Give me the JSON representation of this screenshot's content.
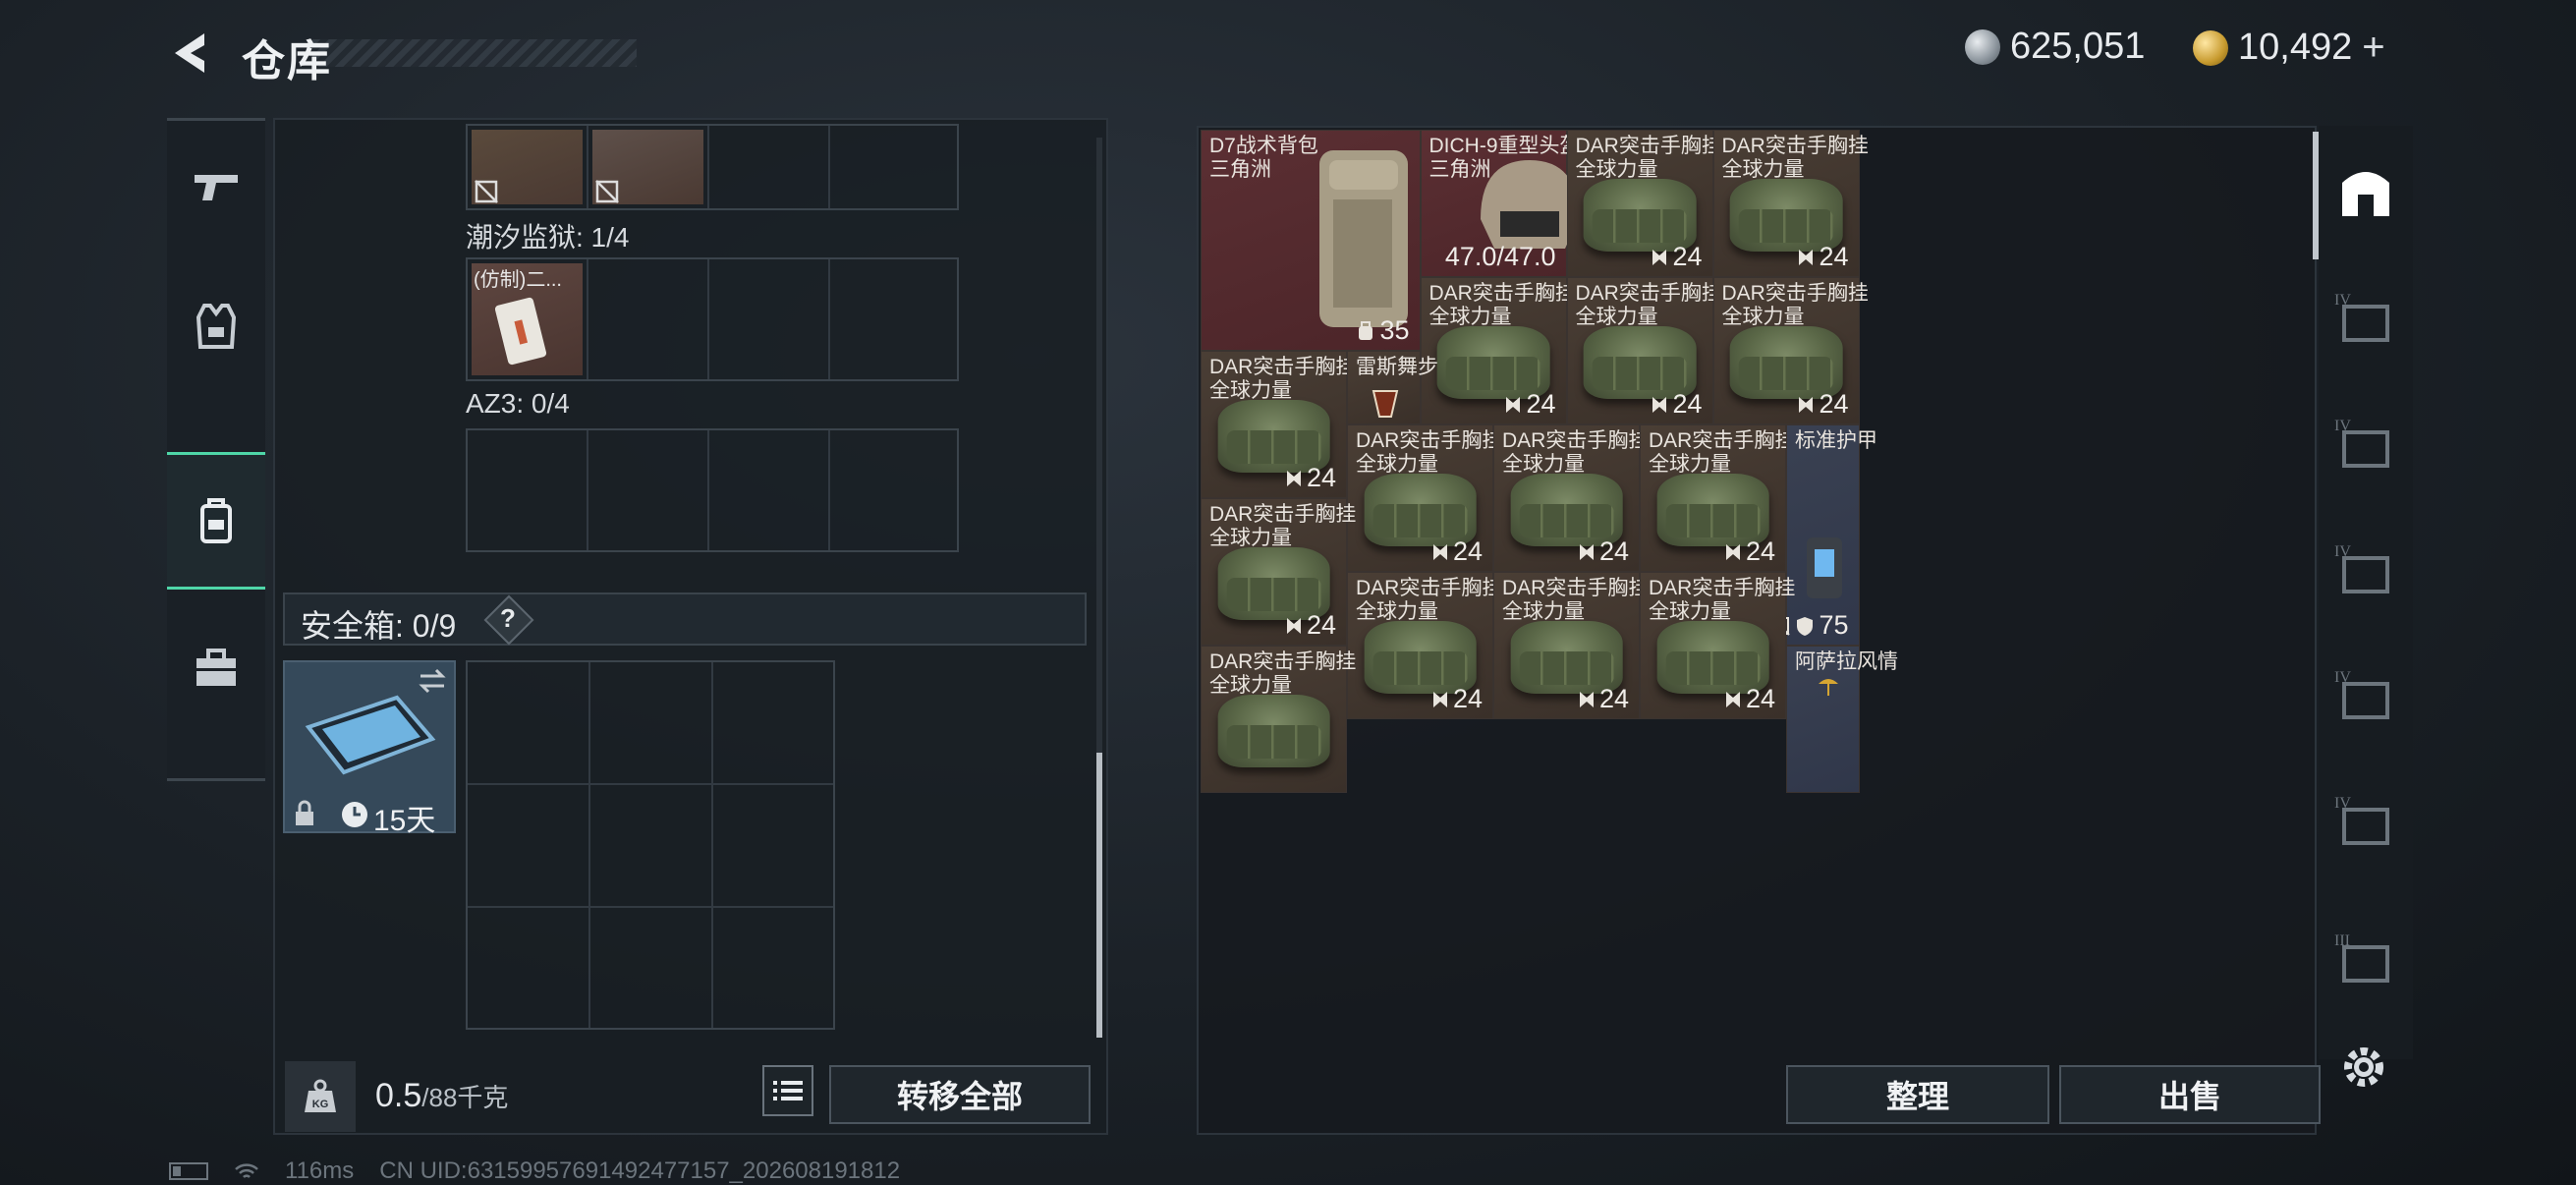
{
  "header": {
    "title": "仓库",
    "back_icon": "chevron-left-icon"
  },
  "currency": {
    "silver_value": "625,051",
    "gold_value": "10,492",
    "plus": "+"
  },
  "nav": {
    "items": [
      {
        "icon": "pistol-icon"
      },
      {
        "icon": "armor-vest-icon"
      },
      {
        "icon": "backpack-icon",
        "active": true
      },
      {
        "icon": "toolbox-icon"
      }
    ]
  },
  "left": {
    "row1_items": [
      {
        "icon": "no-trade-icon"
      },
      {
        "icon": "no-trade-icon"
      }
    ],
    "prison_label": "潮汐监狱: 1/4",
    "replica_label": "(仿制)二...",
    "az3_label": "AZ3: 0/4",
    "safe_label": "安全箱: 0/9",
    "safe_help": "?",
    "safe_days": "15天",
    "weight_value": "0.5",
    "weight_unit": "/88千克",
    "kg_label": "KG",
    "transfer_all": "转移全部"
  },
  "grid": {
    "items": [
      {
        "name": "D7战术背包",
        "sub": "三角洲",
        "count": "35",
        "count_icon": "capacity-icon",
        "color": "red"
      },
      {
        "name": "DICH-9重型头盔",
        "sub": "三角洲",
        "count": "47.0/47.0",
        "color": "red"
      },
      {
        "name": "DAR突击手胸挂",
        "sub": "全球力量",
        "count": "24",
        "color": "brown"
      },
      {
        "name": "DAR突击手胸挂",
        "sub": "全球力量",
        "count": "24",
        "color": "brown"
      },
      {
        "name": "DAR突击手胸挂",
        "sub": "全球力量",
        "count": "24",
        "color": "brown"
      },
      {
        "name": "DAR突击手胸挂",
        "sub": "全球力量",
        "count": "24",
        "color": "brown"
      },
      {
        "name": "DAR突击手胸挂",
        "sub": "全球力量",
        "count": "24",
        "color": "brown"
      },
      {
        "name": "DAR突击手胸挂",
        "sub": "全球力量",
        "count": "24",
        "color": "brown"
      },
      {
        "name": "雷斯舞步",
        "sub": "",
        "count": "",
        "color": "brown"
      },
      {
        "name": "DAR突击手胸挂",
        "sub": "全球力量",
        "count": "24",
        "color": "brown"
      },
      {
        "name": "DAR突击手胸挂",
        "sub": "全球力量",
        "count": "24",
        "color": "brown"
      },
      {
        "name": "DAR突击手胸挂",
        "sub": "全球力量",
        "count": "24",
        "color": "brown"
      },
      {
        "name": "标准护甲",
        "sub": "",
        "count": "75",
        "color": "blue"
      },
      {
        "name": "DAR突击手胸挂",
        "sub": "全球力量",
        "count": "24",
        "color": "brown"
      },
      {
        "name": "DAR突击手胸挂",
        "sub": "全球力量",
        "count": "24",
        "color": "brown"
      },
      {
        "name": "DAR突击手胸挂",
        "sub": "全球力量",
        "count": "24",
        "color": "brown"
      },
      {
        "name": "DAR突击手胸挂",
        "sub": "全球力量",
        "count": "24",
        "color": "brown"
      },
      {
        "name": "DAR突击手胸挂",
        "sub": "全球力量",
        "count": "",
        "color": "brown"
      },
      {
        "name": "阿萨拉风情",
        "sub": "",
        "count": "",
        "color": "blue"
      }
    ]
  },
  "actions": {
    "sort": "整理",
    "sell": "出售"
  },
  "rail": {
    "items": [
      {
        "icon": "storage-icon",
        "active": true
      },
      {
        "icon": "tier-iv-icon"
      },
      {
        "icon": "tier-iv-icon"
      },
      {
        "icon": "tier-iv-icon"
      },
      {
        "icon": "tier-iv-icon"
      },
      {
        "icon": "tier-iv-icon"
      },
      {
        "icon": "tier-iii-icon"
      }
    ],
    "settings_icon": "gear-icon"
  },
  "footer": {
    "ping": "116ms",
    "uid": "CN UID:63159957691492477157_202608191812"
  },
  "colors": {
    "accent": "#4fd6a8",
    "red_cell": "#5b2f33",
    "brown_cell": "#4a3e35",
    "blue_cell": "#3a4152"
  }
}
